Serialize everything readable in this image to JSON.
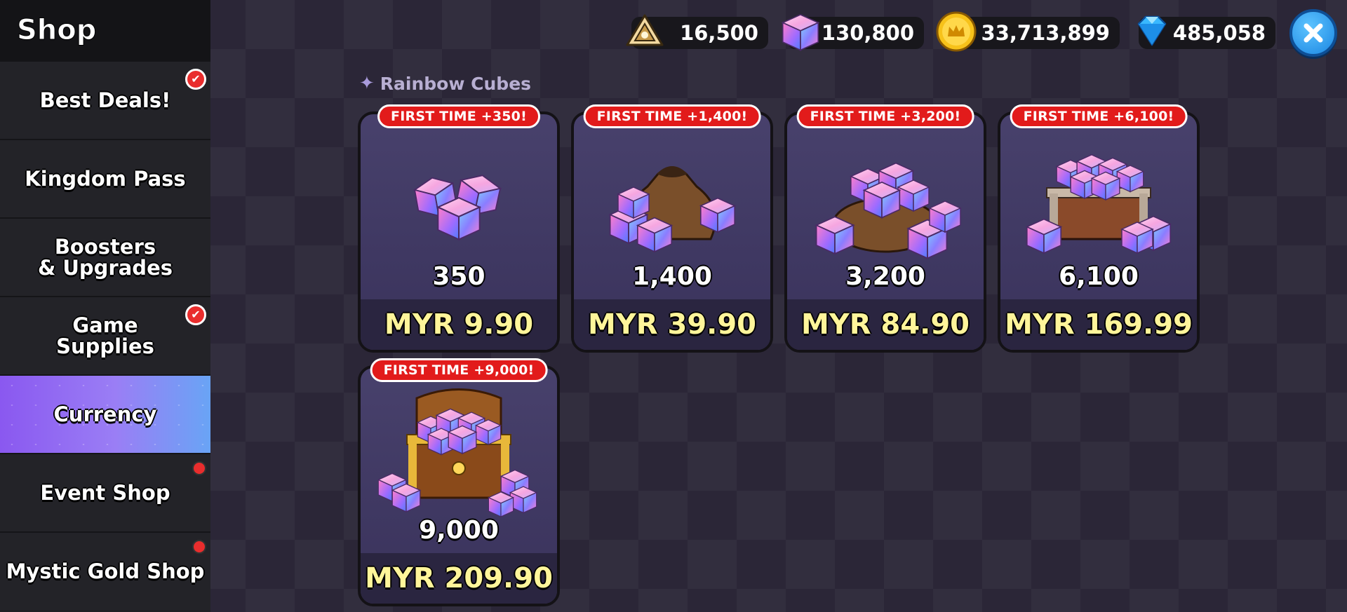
{
  "sidebar": {
    "title": "Shop",
    "items": [
      {
        "label": "Best Deals!",
        "badge": "check"
      },
      {
        "label": "Kingdom Pass",
        "badge": ""
      },
      {
        "label": "Boosters\n& Upgrades",
        "badge": ""
      },
      {
        "label": "Game\nSupplies",
        "badge": "check"
      },
      {
        "label": "Currency",
        "badge": "",
        "active": true
      },
      {
        "label": "Event Shop",
        "badge": "dot"
      },
      {
        "label": "Mystic Gold Shop",
        "badge": "dot"
      }
    ]
  },
  "currencies": {
    "soulstone": {
      "icon": "soulstone-icon",
      "value": "16,500"
    },
    "rainbow_cubes": {
      "icon": "rainbow-cube-icon",
      "value": "130,800"
    },
    "coins": {
      "icon": "gold-coin-icon",
      "value": "33,713,899"
    },
    "crystals": {
      "icon": "crystal-icon",
      "value": "485,058"
    }
  },
  "section": {
    "title": "Rainbow Cubes"
  },
  "products": [
    {
      "bonus": "FIRST TIME +350!",
      "amount": "350",
      "price": "MYR 9.90",
      "art": "small-cube-pile"
    },
    {
      "bonus": "FIRST TIME +1,400!",
      "amount": "1,400",
      "price": "MYR 39.90",
      "art": "cube-sack"
    },
    {
      "bonus": "FIRST TIME +3,200!",
      "amount": "3,200",
      "price": "MYR 84.90",
      "art": "large-cube-sack"
    },
    {
      "bonus": "FIRST TIME +6,100!",
      "amount": "6,100",
      "price": "MYR 169.99",
      "art": "cube-crate"
    },
    {
      "bonus": "FIRST TIME +9,000!",
      "amount": "9,000",
      "price": "MYR 209.90",
      "art": "cube-treasure-chest"
    }
  ],
  "colors": {
    "price": "#fff59a",
    "bonus_badge": "#e21b1b",
    "active_tab": "#8a58f0",
    "card": "#453e69"
  }
}
